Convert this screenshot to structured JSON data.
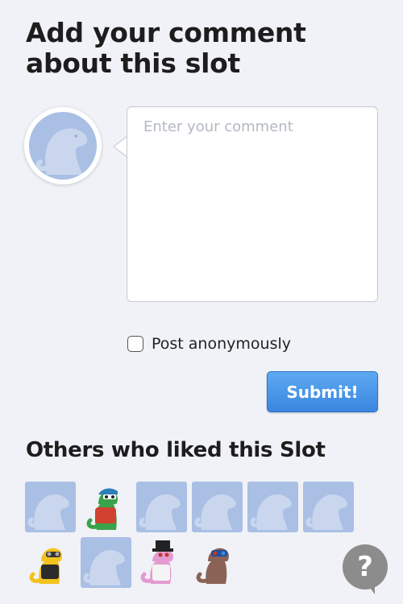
{
  "heading": "Add your comment about this slot",
  "comment": {
    "placeholder": "Enter your comment",
    "value": ""
  },
  "anonymous": {
    "label": "Post anonymously",
    "checked": false
  },
  "submit_label": "Submit!",
  "likers_title": "Others who liked this Slot",
  "likers": [
    {
      "kind": "placeholder"
    },
    {
      "kind": "green-dino-cap-backpack"
    },
    {
      "kind": "placeholder"
    },
    {
      "kind": "placeholder"
    },
    {
      "kind": "placeholder"
    },
    {
      "kind": "placeholder"
    },
    {
      "kind": "yellow-dino-aviator-glasses"
    },
    {
      "kind": "placeholder"
    },
    {
      "kind": "pink-dino-top-hat"
    },
    {
      "kind": "brown-dino-3d-glasses"
    }
  ],
  "help_label": "?",
  "colors": {
    "accent": "#3a86df",
    "placeholder_tile": "#a9bfe4",
    "background": "#f0f2f7"
  }
}
